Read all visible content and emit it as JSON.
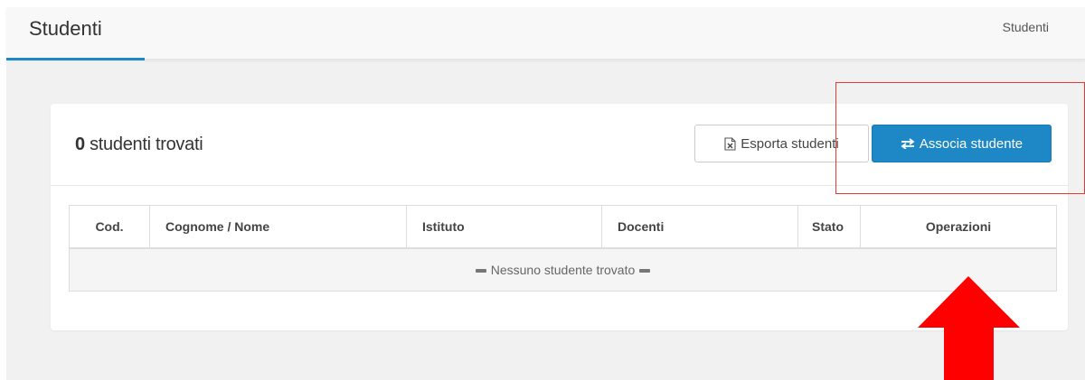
{
  "header": {
    "title": "Studenti",
    "breadcrumb": "Studenti"
  },
  "panel": {
    "count": "0",
    "count_suffix": " studenti trovati",
    "export_label": "Esporta studenti",
    "export_icon": "excel-file-icon",
    "assoc_label": "Associa studente",
    "assoc_icon": "exchange-arrows-icon"
  },
  "table": {
    "columns": [
      "Cod.",
      "Cognome / Nome",
      "Istituto",
      "Docenti",
      "Stato",
      "Operazioni"
    ],
    "empty_message": "Nessuno studente trovato"
  },
  "colors": {
    "accent": "#1e88c7",
    "annotation": "#ff0000"
  }
}
